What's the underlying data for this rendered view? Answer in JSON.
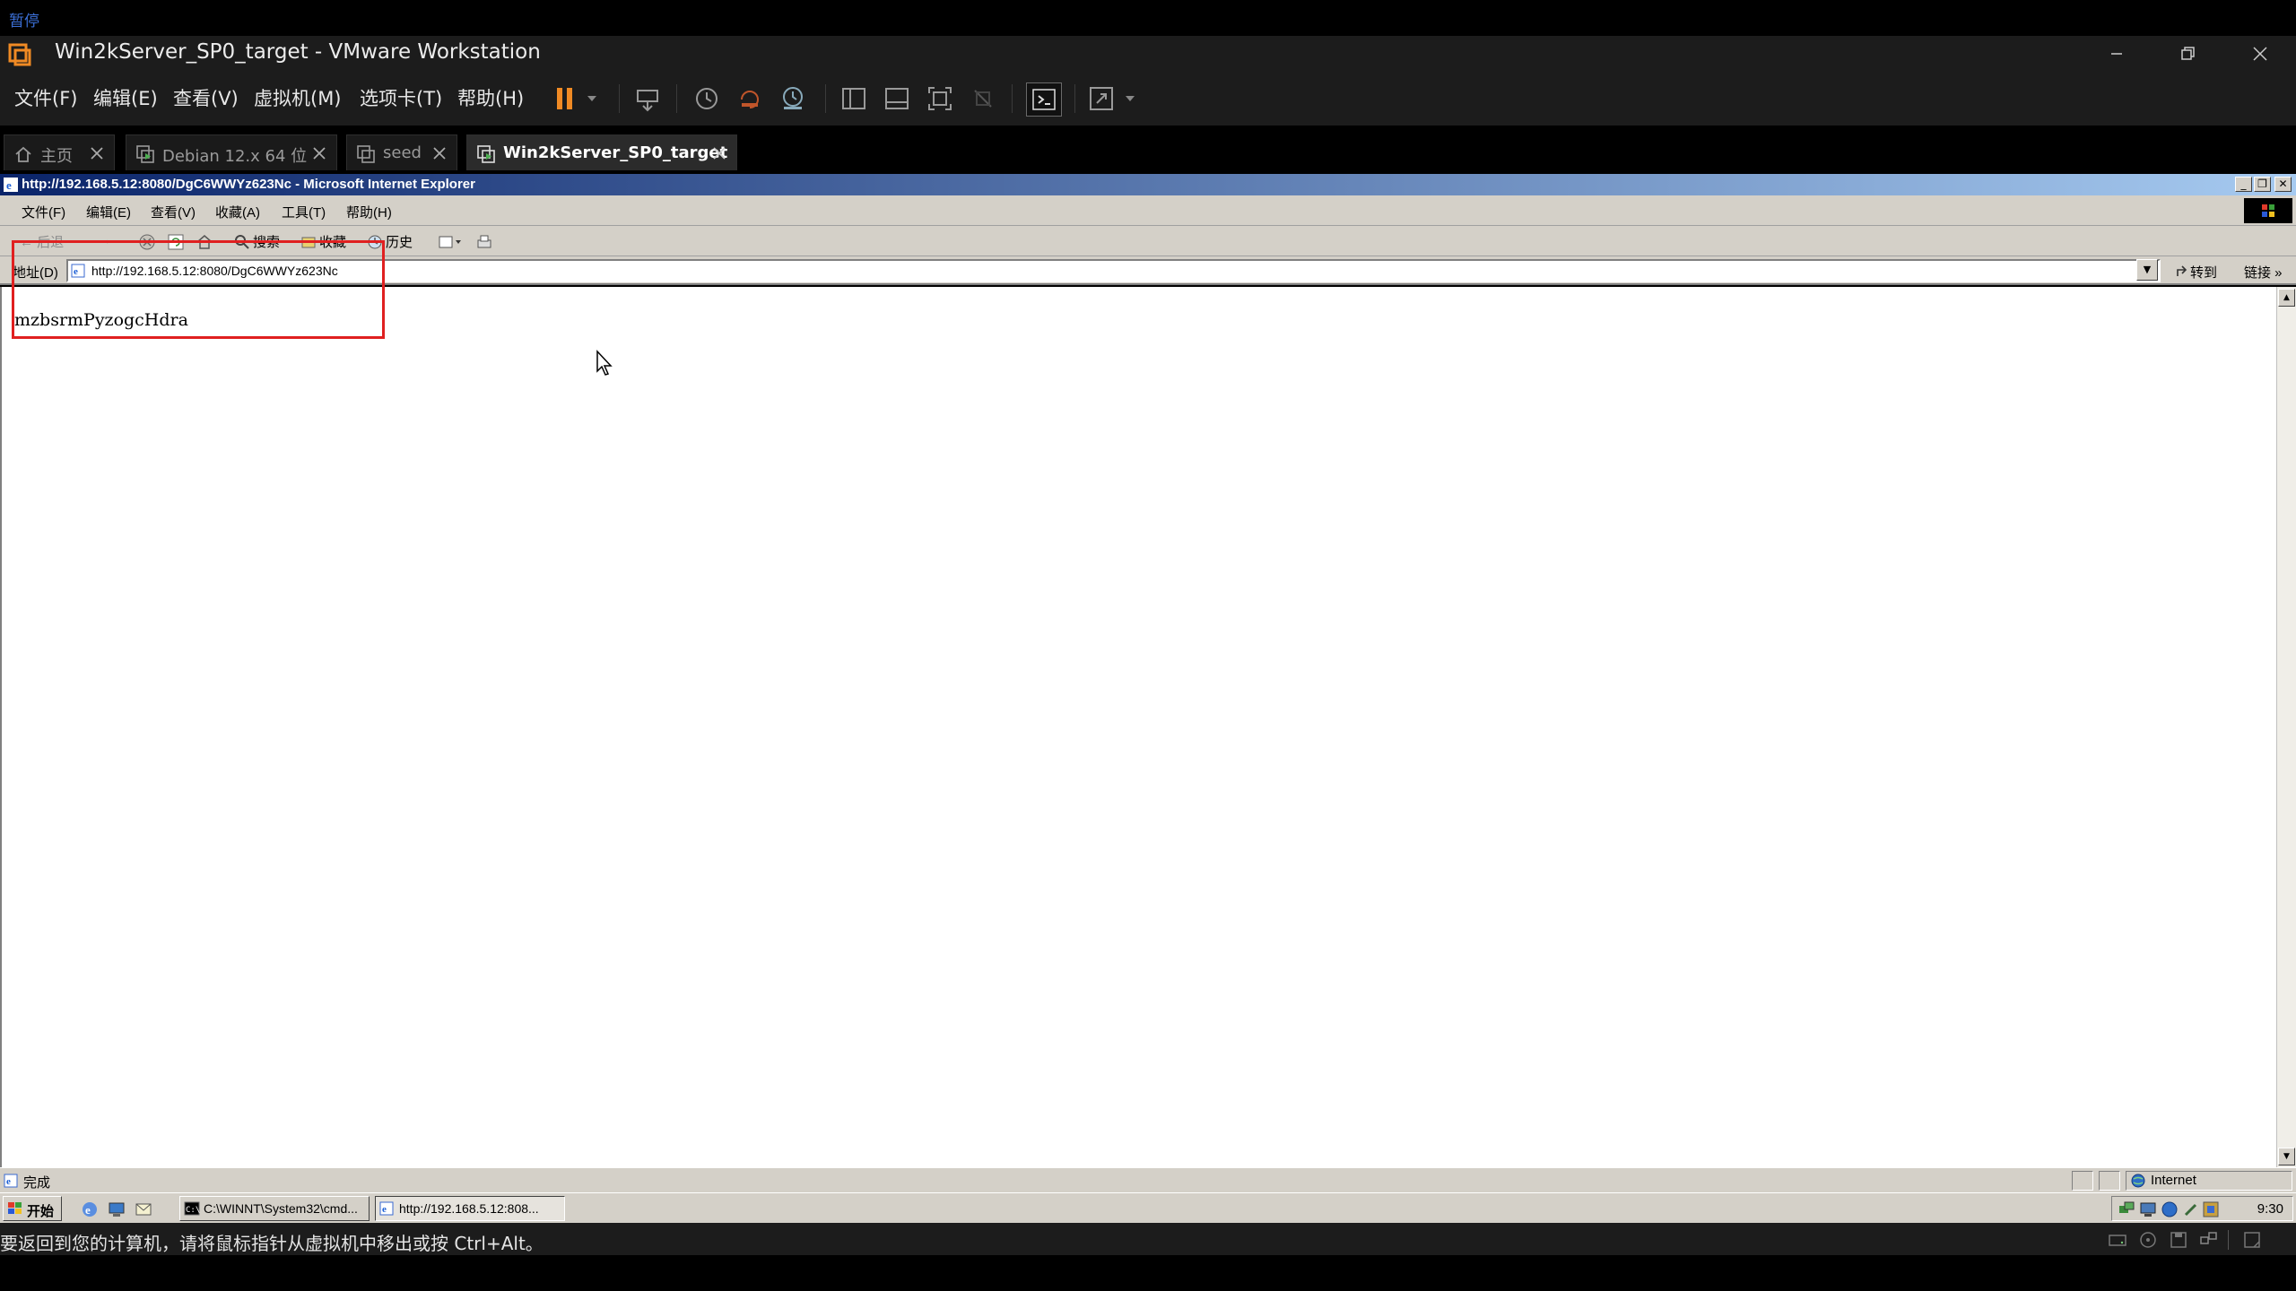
{
  "vmware": {
    "pause_label": "暂停",
    "window_title": "Win2kServer_SP0_target - VMware Workstation",
    "menu": [
      "文件(F)",
      "编辑(E)",
      "查看(V)",
      "虚拟机(M)",
      "选项卡(T)",
      "帮助(H)"
    ],
    "tabs": [
      {
        "label": "主页",
        "icon": "home-icon"
      },
      {
        "label": "Debian 12.x 64 位",
        "icon": "vm-icon"
      },
      {
        "label": "seed",
        "icon": "vm-icon"
      },
      {
        "label": "Win2kServer_SP0_target",
        "icon": "vm-icon",
        "active": true
      }
    ],
    "hint": "要返回到您的计算机，请将鼠标指针从虚拟机中移出或按 Ctrl+Alt。",
    "accent": "#f08a24"
  },
  "ie": {
    "title": "http://192.168.5.12:8080/DgC6WWYz623Nc - Microsoft Internet Explorer",
    "menu": [
      "文件(F)",
      "编辑(E)",
      "查看(V)",
      "收藏(A)",
      "工具(T)",
      "帮助(H)"
    ],
    "toolbar": {
      "back": "← 后退",
      "forward": "→",
      "search": "搜索",
      "favorites": "收藏",
      "history": "历史"
    },
    "address_label": "地址(D)",
    "address_url": "http://192.168.5.12:8080/DgC6WWYz623Nc",
    "go_label": "转到",
    "links_label": "链接 »",
    "content_text": "mzbsrmPyzogcHdra",
    "status_text": "完成",
    "zone_label": "Internet"
  },
  "taskbar": {
    "start_label": "开始",
    "tasks": [
      "C:\\WINNT\\System32\\cmd...",
      "http://192.168.5.12:808..."
    ],
    "clock": "9:30"
  },
  "colors": {
    "ie_title_start": "#0a246a",
    "ie_title_end": "#a6caf0",
    "highlight_box": "#e02020"
  }
}
